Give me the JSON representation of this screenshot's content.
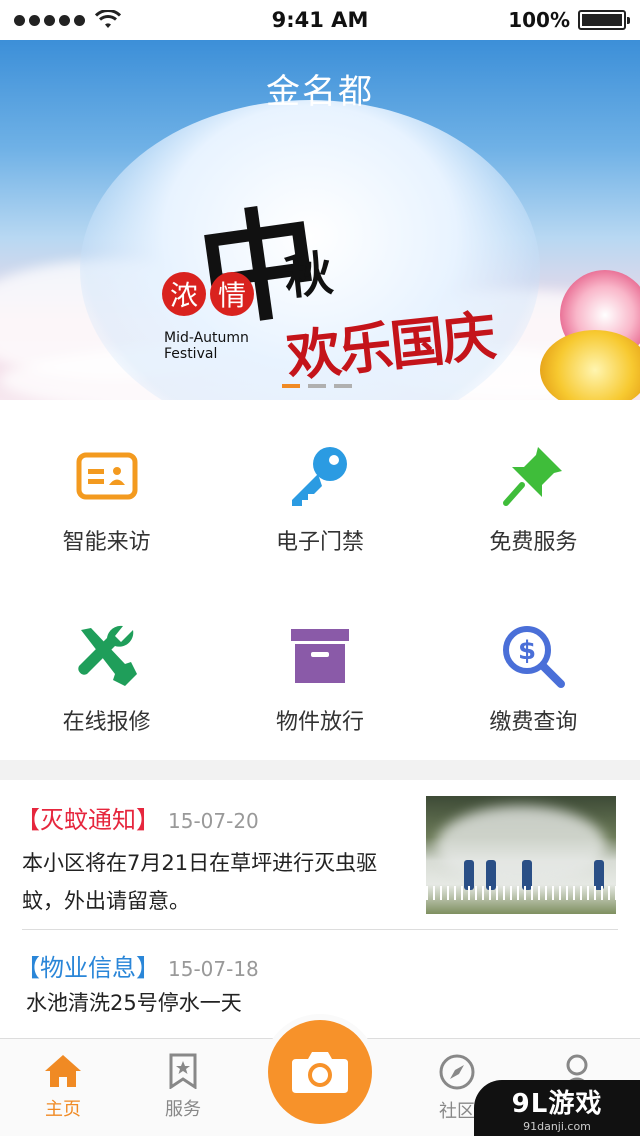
{
  "status_bar": {
    "time": "9:41 AM",
    "battery": "100%"
  },
  "banner": {
    "title": "金名都",
    "seal_chars": [
      "浓",
      "情"
    ],
    "calligraphy_main": "中",
    "calligraphy_sub": "秋",
    "festival_text": "欢乐国庆",
    "mid_autumn": "Mid-Autumn",
    "festival_en": "Festival",
    "page_count": 3,
    "active_index": 0
  },
  "services": [
    {
      "label": "智能来访",
      "icon": "visitor-card-icon",
      "color": "#f39a1f"
    },
    {
      "label": "电子门禁",
      "icon": "key-icon",
      "color": "#2b9be2"
    },
    {
      "label": "免费服务",
      "icon": "pin-icon",
      "color": "#3fbd3a"
    },
    {
      "label": "在线报修",
      "icon": "wrench-screwdriver-icon",
      "color": "#1f9e5a"
    },
    {
      "label": "物件放行",
      "icon": "box-icon",
      "color": "#8a5aa8"
    },
    {
      "label": "缴费查询",
      "icon": "payment-search-icon",
      "color": "#4a6fd8"
    }
  ],
  "news": [
    {
      "tag": "【灭蚊通知】",
      "date": "15-07-20",
      "body": "本小区将在7月21日在草坪进行灭虫驱蚊，外出请留意。",
      "tag_color": "#e6263d"
    },
    {
      "tag": "【物业信息】",
      "date": "15-07-18",
      "body": "水池清洗25号停水一天",
      "tag_color": "#2a86d8"
    }
  ],
  "tabbar": {
    "home": "主页",
    "service": "服务",
    "community": "社区",
    "active": "home"
  },
  "watermark": {
    "main": "9L游戏",
    "sub": "91danji.com"
  }
}
